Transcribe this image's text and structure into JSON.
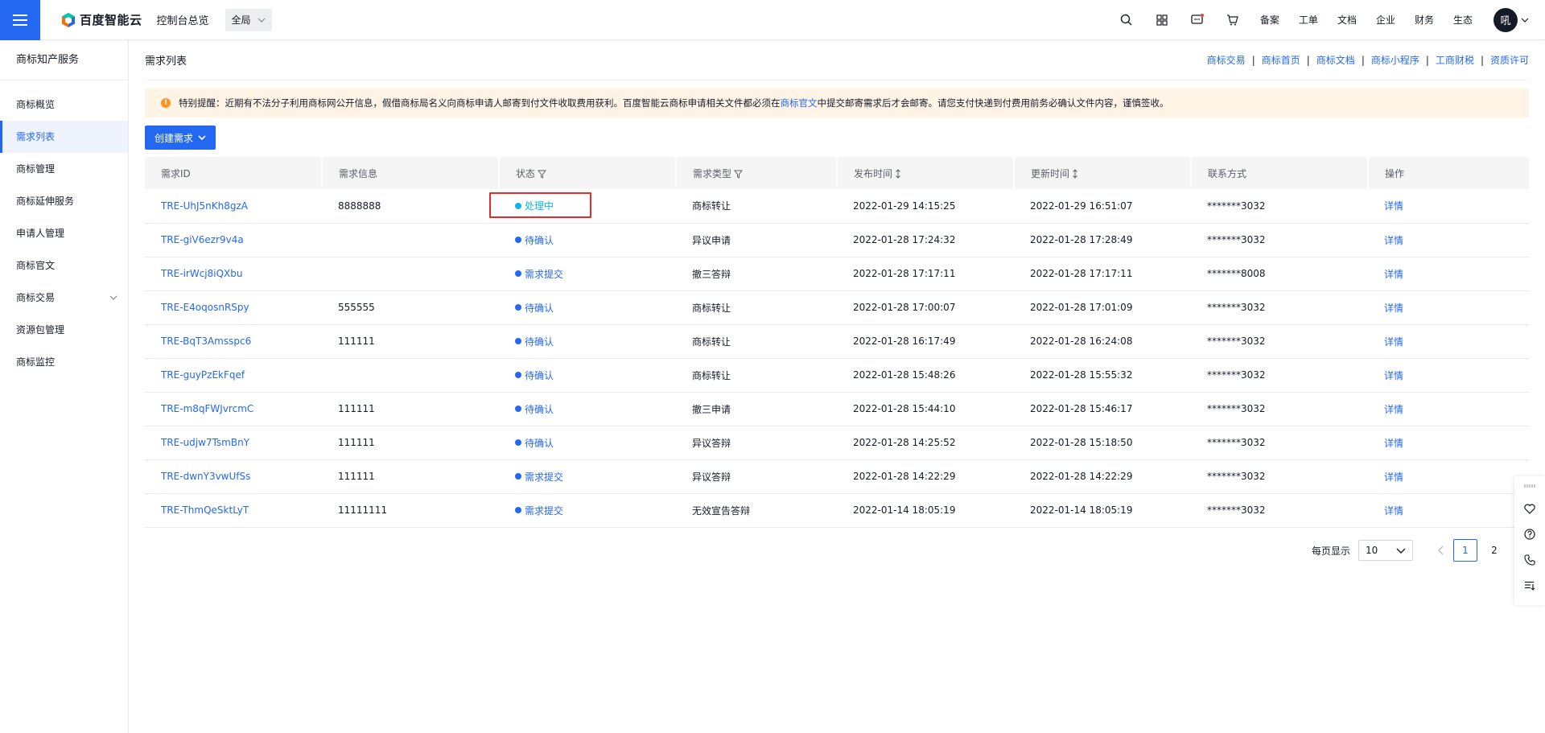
{
  "topbar": {
    "brand": "百度智能云",
    "console": "控制台总览",
    "region": "全局",
    "nav": [
      "备案",
      "工单",
      "文档",
      "企业",
      "财务",
      "生态"
    ],
    "avatar_text": "吼"
  },
  "sidebar": {
    "title": "商标知产服务",
    "items": [
      {
        "label": "商标概览"
      },
      {
        "label": "需求列表"
      },
      {
        "label": "商标管理"
      },
      {
        "label": "商标延伸服务"
      },
      {
        "label": "申请人管理"
      },
      {
        "label": "商标官文"
      },
      {
        "label": "商标交易"
      },
      {
        "label": "资源包管理"
      },
      {
        "label": "商标监控"
      }
    ]
  },
  "page": {
    "title": "需求列表",
    "quick_links": [
      "商标交易",
      "商标首页",
      "商标文档",
      "商标小程序",
      "工商财税",
      "资质许可"
    ],
    "separator": "|",
    "notice_prefix": "特别提醒：近期有不法分子利用商标网公开信息，假借商标局名义向商标申请人邮寄到付文件收取费用获利。百度智能云商标申请相关文件都必须在",
    "notice_link": "商标官文",
    "notice_suffix": "中提交邮寄需求后才会邮寄。请您支付快递到付费用前务必确认文件内容，谨慎签收。",
    "create_button": "创建需求"
  },
  "table": {
    "headers": [
      "需求ID",
      "需求信息",
      "状态",
      "需求类型",
      "发布时间",
      "更新时间",
      "联系方式",
      "操作"
    ],
    "rows": [
      {
        "id": "TRE-UhJ5nKh8gzA",
        "info": "8888888",
        "status": "处理中",
        "type": "商标转让",
        "published": "2022-01-29 14:15:25",
        "updated": "2022-01-29 16:51:07",
        "contact": "*******3032",
        "action": "详情"
      },
      {
        "id": "TRE-giV6ezr9v4a",
        "info": "",
        "status": "待确认",
        "type": "异议申请",
        "published": "2022-01-28 17:24:32",
        "updated": "2022-01-28 17:28:49",
        "contact": "*******3032",
        "action": "详情"
      },
      {
        "id": "TRE-irWcj8iQXbu",
        "info": "",
        "status": "需求提交",
        "type": "撤三答辩",
        "published": "2022-01-28 17:17:11",
        "updated": "2022-01-28 17:17:11",
        "contact": "*******8008",
        "action": "详情"
      },
      {
        "id": "TRE-E4oqosnRSpy",
        "info": "555555",
        "status": "待确认",
        "type": "商标转让",
        "published": "2022-01-28 17:00:07",
        "updated": "2022-01-28 17:01:09",
        "contact": "*******3032",
        "action": "详情"
      },
      {
        "id": "TRE-BqT3Amsspc6",
        "info": "111111",
        "status": "待确认",
        "type": "商标转让",
        "published": "2022-01-28 16:17:49",
        "updated": "2022-01-28 16:24:08",
        "contact": "*******3032",
        "action": "详情"
      },
      {
        "id": "TRE-guyPzEkFqef",
        "info": "",
        "status": "待确认",
        "type": "商标转让",
        "published": "2022-01-28 15:48:26",
        "updated": "2022-01-28 15:55:32",
        "contact": "*******3032",
        "action": "详情"
      },
      {
        "id": "TRE-m8qFWJvrcmC",
        "info": "111111",
        "status": "待确认",
        "type": "撤三申请",
        "published": "2022-01-28 15:44:10",
        "updated": "2022-01-28 15:46:17",
        "contact": "*******3032",
        "action": "详情"
      },
      {
        "id": "TRE-udjw7TsmBnY",
        "info": "111111",
        "status": "待确认",
        "type": "异议答辩",
        "published": "2022-01-28 14:25:52",
        "updated": "2022-01-28 15:18:50",
        "contact": "*******3032",
        "action": "详情"
      },
      {
        "id": "TRE-dwnY3vwUfSs",
        "info": "111111",
        "status": "需求提交",
        "type": "异议答辩",
        "published": "2022-01-28 14:22:29",
        "updated": "2022-01-28 14:22:29",
        "contact": "*******3032",
        "action": "详情"
      },
      {
        "id": "TRE-ThmQeSktLyT",
        "info": "11111111",
        "status": "需求提交",
        "type": "无效宣告答辩",
        "published": "2022-01-14 18:05:19",
        "updated": "2022-01-14 18:05:19",
        "contact": "*******3032",
        "action": "详情"
      }
    ]
  },
  "pagination": {
    "page_size_label": "每页显示",
    "page_size": "10",
    "pages": [
      "1",
      "2"
    ],
    "current": "1"
  },
  "colors": {
    "primary": "#2468f2",
    "processing": "#0fb3ee",
    "highlight": "#e82a2a",
    "notice_bg": "#fff4e6",
    "warn": "#ff9326"
  }
}
